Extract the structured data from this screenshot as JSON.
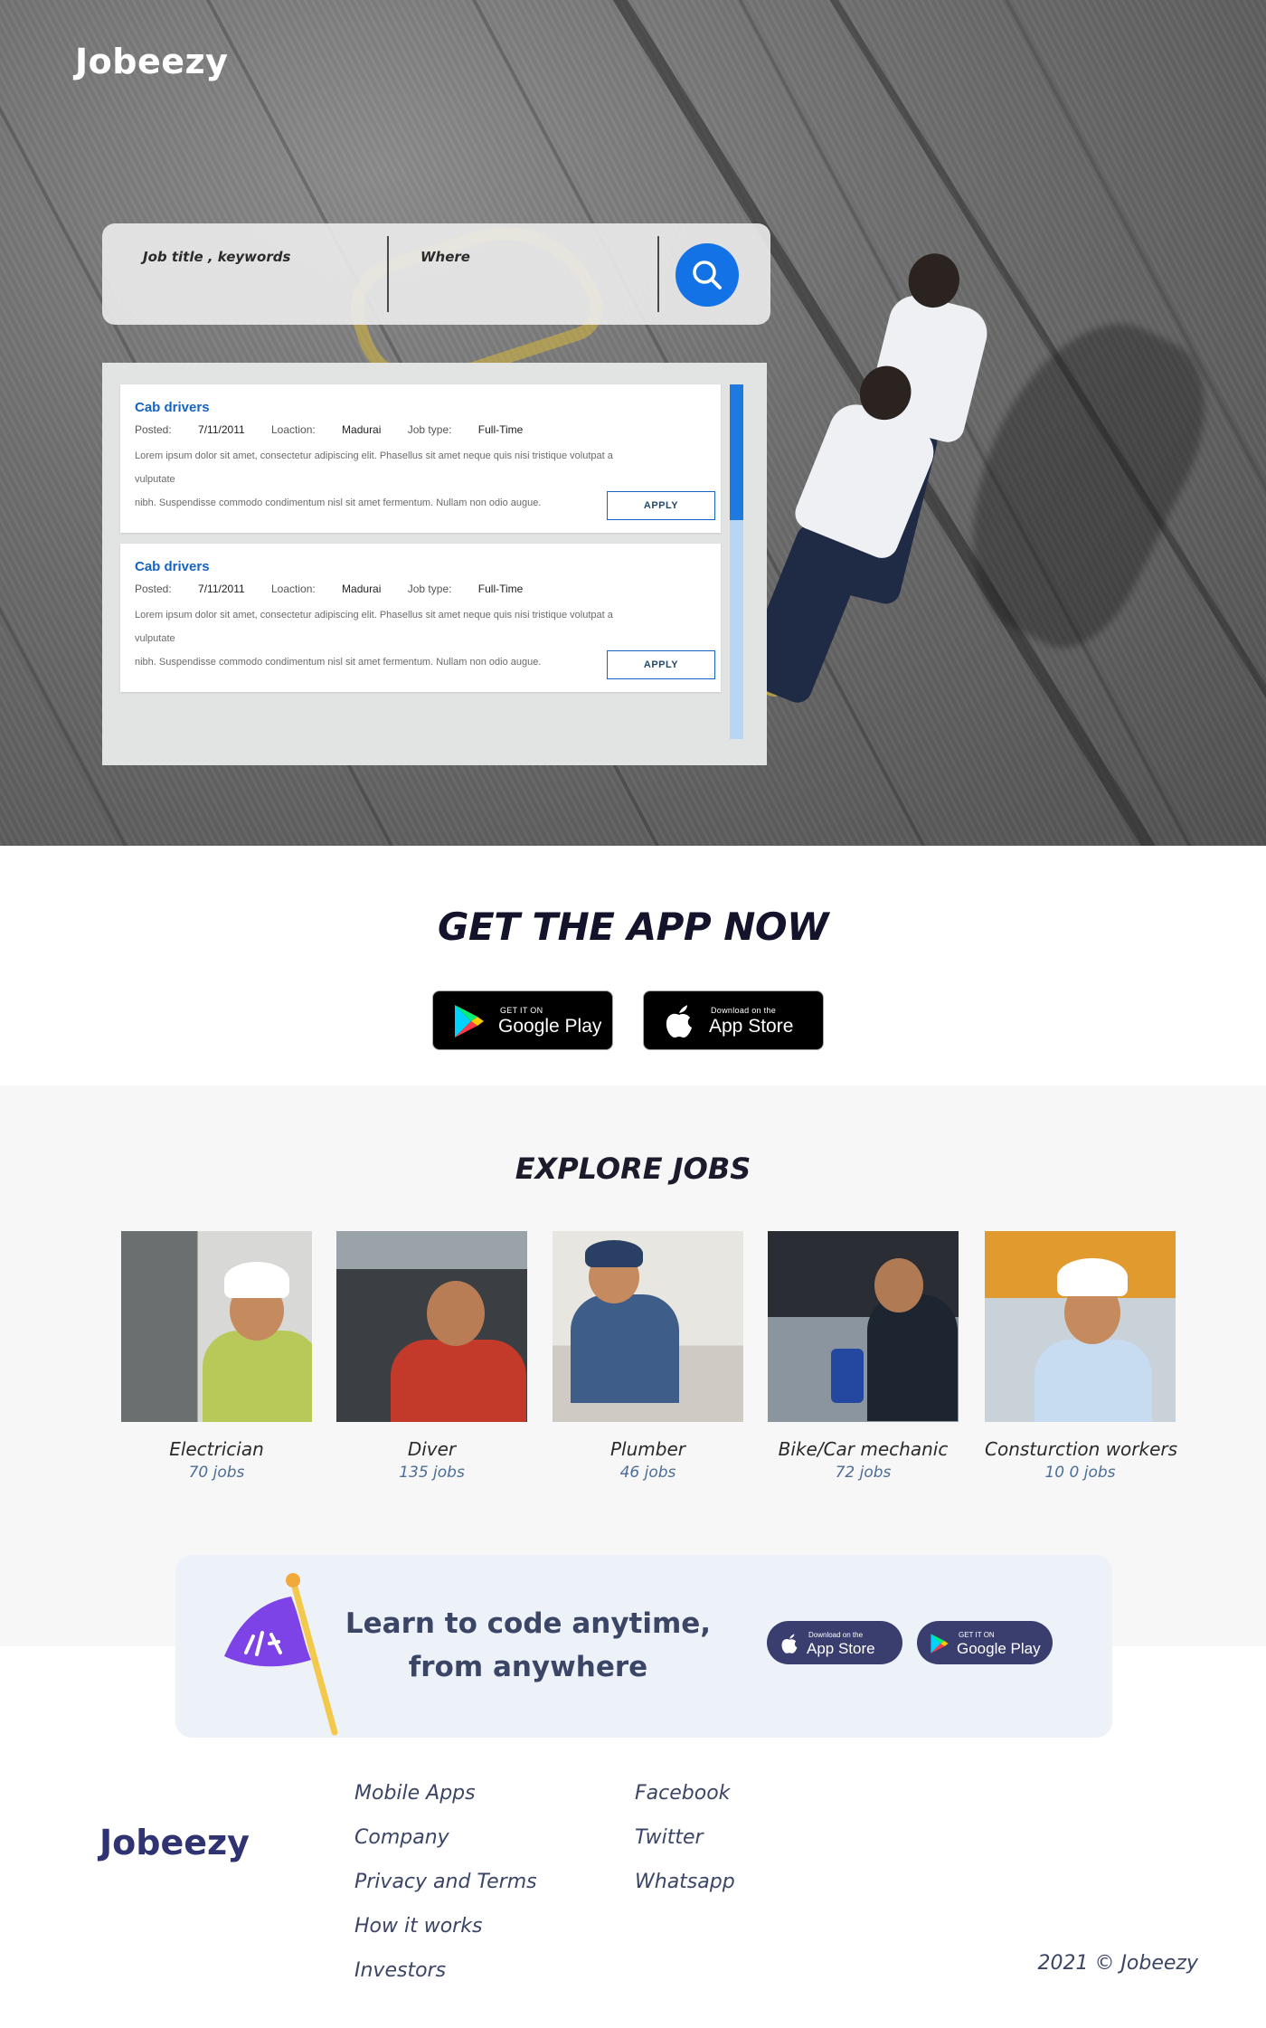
{
  "brand": {
    "name": "Jobeezy"
  },
  "search": {
    "keyword_label": "Job title , keywords",
    "location_label": "Where",
    "button_icon": "search-icon"
  },
  "results": [
    {
      "title": "Cab drivers",
      "posted_label": "Posted:",
      "posted": "7/11/2011",
      "location_label": "Loaction:",
      "location": "Madurai",
      "type_label": "Job type:",
      "type": "Full-Time",
      "desc_line1": "Lorem ipsum dolor sit amet, consectetur adipiscing elit. Phasellus sit amet neque quis nisi tristique volutpat a",
      "desc_line2": "vulputate",
      "desc_line3": "nibh. Suspendisse commodo condimentum nisl sit amet fermentum. Nullam non odio augue.",
      "apply_label": "APPLY"
    },
    {
      "title": "Cab drivers",
      "posted_label": "Posted:",
      "posted": "7/11/2011",
      "location_label": "Loaction:",
      "location": "Madurai",
      "type_label": "Job type:",
      "type": "Full-Time",
      "desc_line1": "Lorem ipsum dolor sit amet, consectetur adipiscing elit. Phasellus sit amet neque quis nisi tristique volutpat a",
      "desc_line2": "vulputate",
      "desc_line3": "nibh. Suspendisse commodo condimentum nisl sit amet fermentum. Nullam non odio augue.",
      "apply_label": "APPLY"
    }
  ],
  "get_app": {
    "title": "GET THE APP NOW",
    "google_play": {
      "small": "GET IT ON",
      "big": "Google Play"
    },
    "app_store": {
      "small": "Download on the",
      "big": "App Store"
    }
  },
  "explore": {
    "title": "EXPLORE JOBS",
    "categories": [
      {
        "name": "Electrician",
        "count": "70 jobs"
      },
      {
        "name": "Diver",
        "count": "135 jobs"
      },
      {
        "name": "Plumber",
        "count": "46 jobs"
      },
      {
        "name": "Bike/Car mechanic",
        "count": "72 jobs"
      },
      {
        "name": "Consturction workers",
        "count": "10 0 jobs"
      }
    ]
  },
  "learn": {
    "line1": "Learn to code anytime,",
    "line2": "from anywhere",
    "app_store": {
      "small": "Download on the",
      "big": "App Store"
    },
    "google_play": {
      "small": "GET IT ON",
      "big": "Google Play"
    }
  },
  "footer": {
    "col1": [
      "Mobile Apps",
      "Company",
      "Privacy and Terms",
      "How it works",
      "Investors"
    ],
    "col2": [
      "Facebook",
      "Twitter",
      "Whatsapp"
    ],
    "copyright": "2021  © Jobeezy"
  },
  "colors": {
    "accent": "#1272e6",
    "link_blue": "#1565c0",
    "footer_text": "#3b4566",
    "brand_dark": "#2f3372",
    "pill_bg": "#3a3e6e"
  }
}
